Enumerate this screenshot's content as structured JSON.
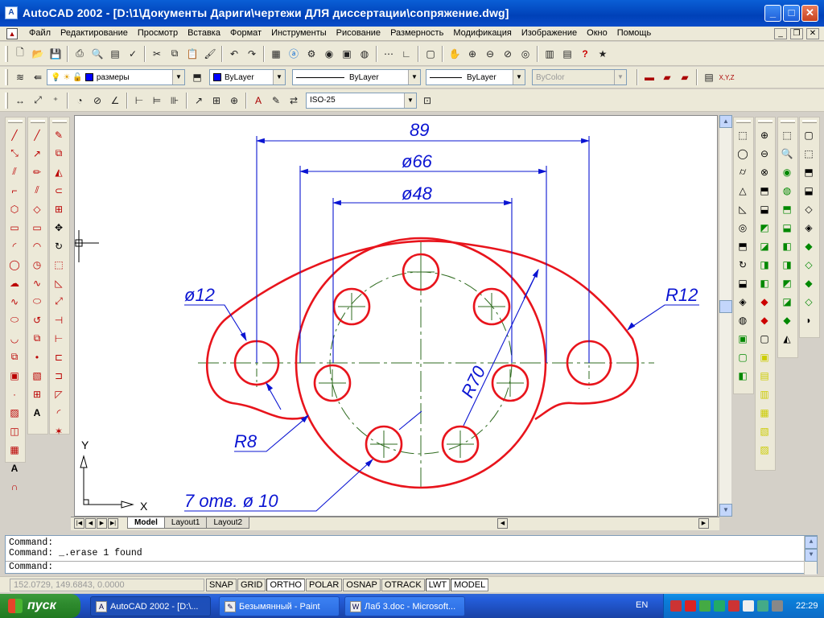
{
  "window": {
    "title": "AutoCAD 2002 - [D:\\1\\Документы Дариги\\чертежи ДЛЯ диссертации\\сопряжение.dwg]",
    "minimize": "_",
    "maximize": "□",
    "close": "✕"
  },
  "menu": {
    "items": [
      "Файл",
      "Редактирование",
      "Просмотр",
      "Вставка",
      "Формат",
      "Инструменты",
      "Рисование",
      "Размерность",
      "Модификация",
      "Изображение",
      "Окно",
      "Помощь"
    ],
    "doc_min": "_",
    "doc_restore": "❐",
    "doc_close": "✕"
  },
  "layers_toolbar": {
    "layer_value": "размеры",
    "color_value": "ByLayer",
    "linetype_value": "ByLayer",
    "lineweight_value": "ByLayer",
    "plotstyle_value": "ByColor"
  },
  "dim_toolbar": {
    "dimstyle_value": "ISO-25"
  },
  "drawing": {
    "dim_overall": "89",
    "dim_d66": "ø66",
    "dim_d48": "ø48",
    "label_d12": "ø12",
    "label_r12": "R12",
    "label_r70": "R70",
    "label_r8": "R8",
    "label_holes": "7 отв. ø 10",
    "ucs_y": "Y",
    "ucs_x": "X",
    "colors": {
      "outline": "#e8141c",
      "dimension": "#0a14d2",
      "centerline": "#2f6b1f"
    }
  },
  "layout_tabs": {
    "tabs": [
      "Model",
      "Layout1",
      "Layout2"
    ],
    "active": "Model"
  },
  "command": {
    "lines": [
      "Command:",
      "Command: _.erase 1 found",
      "Command:"
    ]
  },
  "status": {
    "coords": "152.0729, 149.6843, 0.0000",
    "toggles": [
      {
        "label": "SNAP",
        "on": false
      },
      {
        "label": "GRID",
        "on": false
      },
      {
        "label": "ORTHO",
        "on": true
      },
      {
        "label": "POLAR",
        "on": false
      },
      {
        "label": "OSNAP",
        "on": false
      },
      {
        "label": "OTRACK",
        "on": false
      },
      {
        "label": "LWT",
        "on": true
      },
      {
        "label": "MODEL",
        "on": true
      }
    ]
  },
  "taskbar": {
    "start_label": "пуск",
    "items": [
      {
        "label": "AutoCAD 2002 - [D:\\...",
        "active": true
      },
      {
        "label": "Безымянный - Paint",
        "active": false
      },
      {
        "label": "Лаб 3.doc - Microsoft...",
        "active": false
      }
    ],
    "language": "EN",
    "clock": "22:29"
  }
}
